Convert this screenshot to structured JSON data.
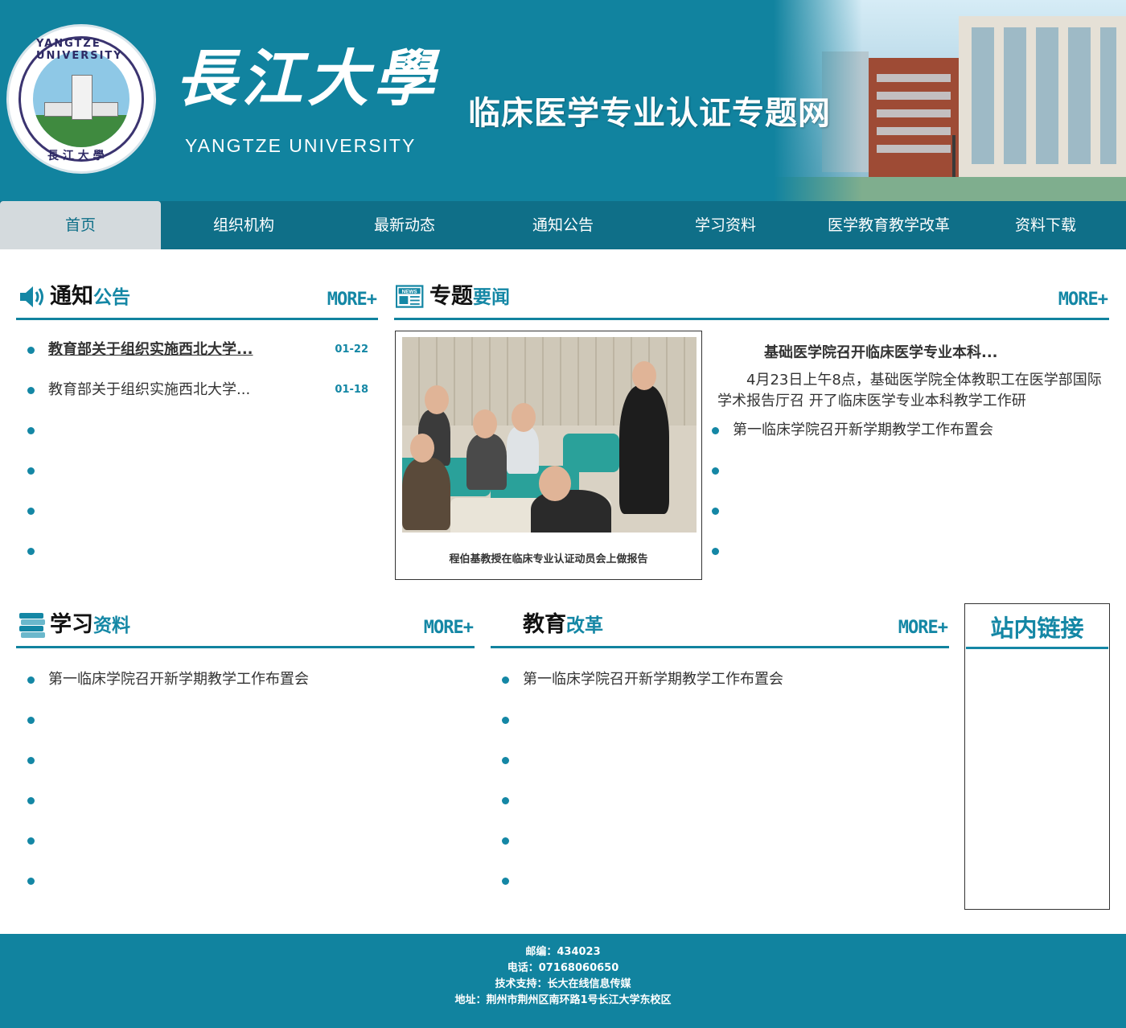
{
  "header": {
    "seal_text_en": "YANGTZE UNIVERSITY",
    "seal_text_cn": "長 江 大 學",
    "brand_cn": "長江大學",
    "brand_en": "YANGTZE UNIVERSITY",
    "site_title": "临床医学专业认证专题网"
  },
  "nav": {
    "items": [
      {
        "label": "首页",
        "active": true
      },
      {
        "label": "组织机构"
      },
      {
        "label": "最新动态"
      },
      {
        "label": "通知公告"
      },
      {
        "label": "学习资料"
      },
      {
        "label": "医学教育教学改革"
      },
      {
        "label": "资料下载"
      }
    ]
  },
  "notices": {
    "title_a": "通知",
    "title_b": "公告",
    "more": "MORE+",
    "items": [
      {
        "text": "教育部关于组织实施西北大学...",
        "date": "01-22"
      },
      {
        "text": "教育部关于组织实施西北大学...",
        "date": "01-18"
      },
      {
        "text": "",
        "date": ""
      },
      {
        "text": "",
        "date": ""
      },
      {
        "text": "",
        "date": ""
      },
      {
        "text": "",
        "date": ""
      }
    ]
  },
  "news": {
    "title_a": "专题",
    "title_b": "要闻",
    "icon_label": "NEWS",
    "more": "MORE+",
    "photo_caption": "程伯基教授在临床专业认证动员会上做报告",
    "headline": "基础医学院召开临床医学专业本科...",
    "summary": "4月23日上午8点，基础医学院全体教职工在医学部国际学术报告厅召 开了临床医学专业本科教学工作研",
    "items": [
      "第一临床学院召开新学期教学工作布置会",
      "",
      "",
      ""
    ]
  },
  "study": {
    "title_a": "学习",
    "title_b": "资料",
    "more": "MORE+",
    "items": [
      "第一临床学院召开新学期教学工作布置会",
      "",
      "",
      "",
      "",
      ""
    ]
  },
  "reform": {
    "title_a": "教育",
    "title_b": "改革",
    "more": "MORE+",
    "items": [
      "第一临床学院召开新学期教学工作布置会",
      "",
      "",
      "",
      "",
      ""
    ]
  },
  "links": {
    "title": "站内链接"
  },
  "footer": {
    "postcode": "邮编：434023",
    "phone": "电话：07168060650",
    "support": "技术支持：长大在线信息传媒",
    "address": "地址：荆州市荆州区南环路1号长江大学东校区"
  },
  "colors": {
    "brand": "#11839f",
    "nav": "#0f6f88",
    "accent": "#1487a5",
    "nav_active": "#d4dadd"
  }
}
